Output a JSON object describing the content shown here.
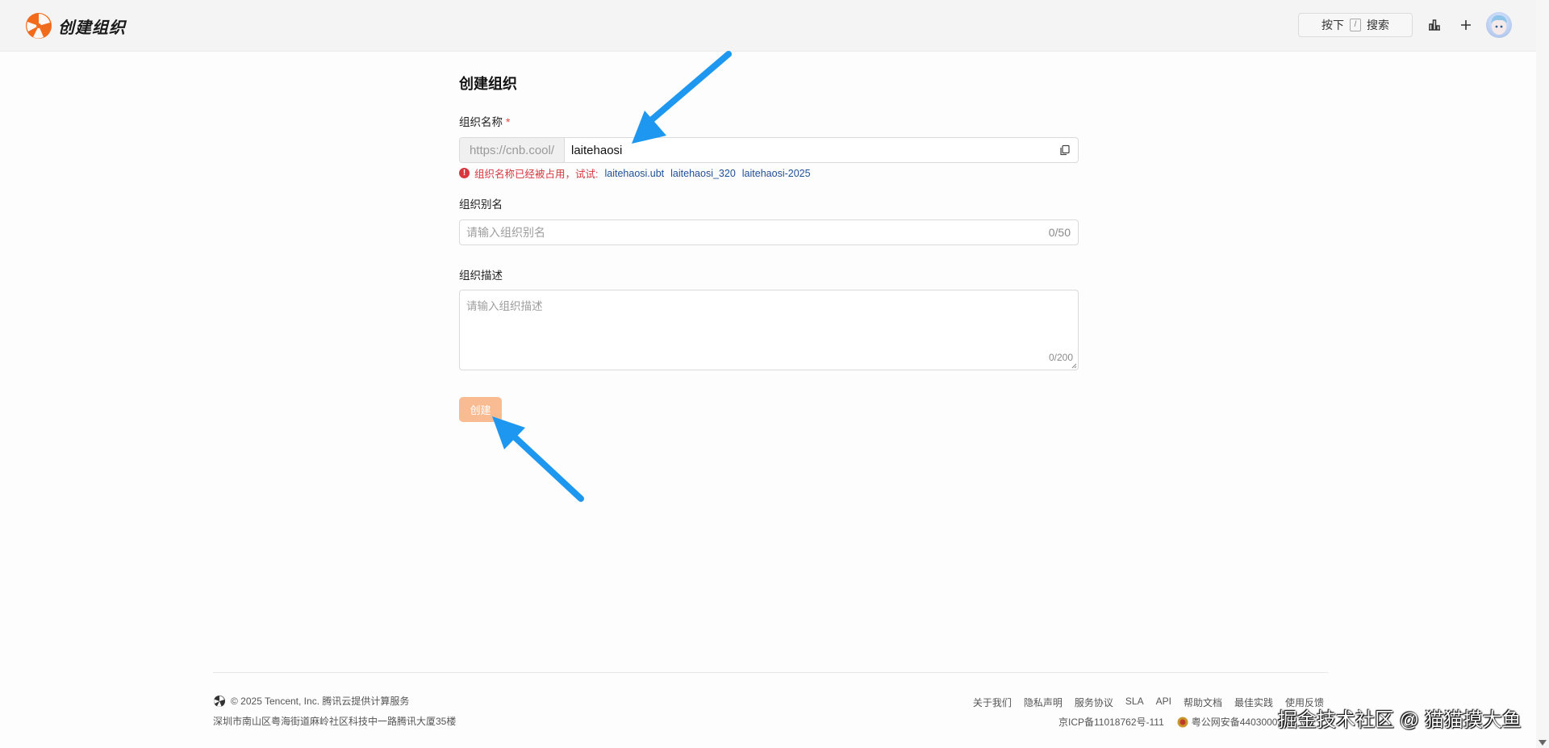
{
  "header": {
    "app_title": "创建组织",
    "search": {
      "press_label": "按下",
      "shortcut_key": "/",
      "search_label": "搜索"
    },
    "icons": {
      "logo": "tencent-cnb-logo-icon",
      "chart": "bar-chart-icon",
      "add": "plus-icon",
      "avatar": "user-avatar"
    }
  },
  "form": {
    "page_title": "创建组织",
    "org_name": {
      "label": "组织名称",
      "required_mark": "*",
      "prefix": "https://cnb.cool/",
      "value": "laitehaosi",
      "error": "组织名称已经被占用，试试:",
      "suggestions": [
        "laitehaosi.ubt",
        "laitehaosi_320",
        "laitehaosi-2025"
      ]
    },
    "org_alias": {
      "label": "组织别名",
      "placeholder": "请输入组织别名",
      "counter": "0/50"
    },
    "org_desc": {
      "label": "组织描述",
      "placeholder": "请输入组织描述",
      "counter": "0/200"
    },
    "submit_label": "创建",
    "submit_color": "#f9bb91"
  },
  "footer": {
    "copyright": "© 2025 Tencent, Inc. 腾讯云提供计算服务",
    "address": "深圳市南山区粤海街道麻岭社区科技中一路腾讯大厦35楼",
    "links": [
      "关于我们",
      "隐私声明",
      "服务协议",
      "SLA",
      "API",
      "帮助文档",
      "最佳实践",
      "使用反馈"
    ],
    "icp": "京ICP备11018762号-111",
    "police": "粤公网安备44030002"
  },
  "watermark": "掘金技术社区 @ 猫猫摸大鱼",
  "colors": {
    "accent": "#f26b1d",
    "error": "#d7373f",
    "link": "#1f4f97",
    "annotation_arrow": "#1e97f0"
  }
}
